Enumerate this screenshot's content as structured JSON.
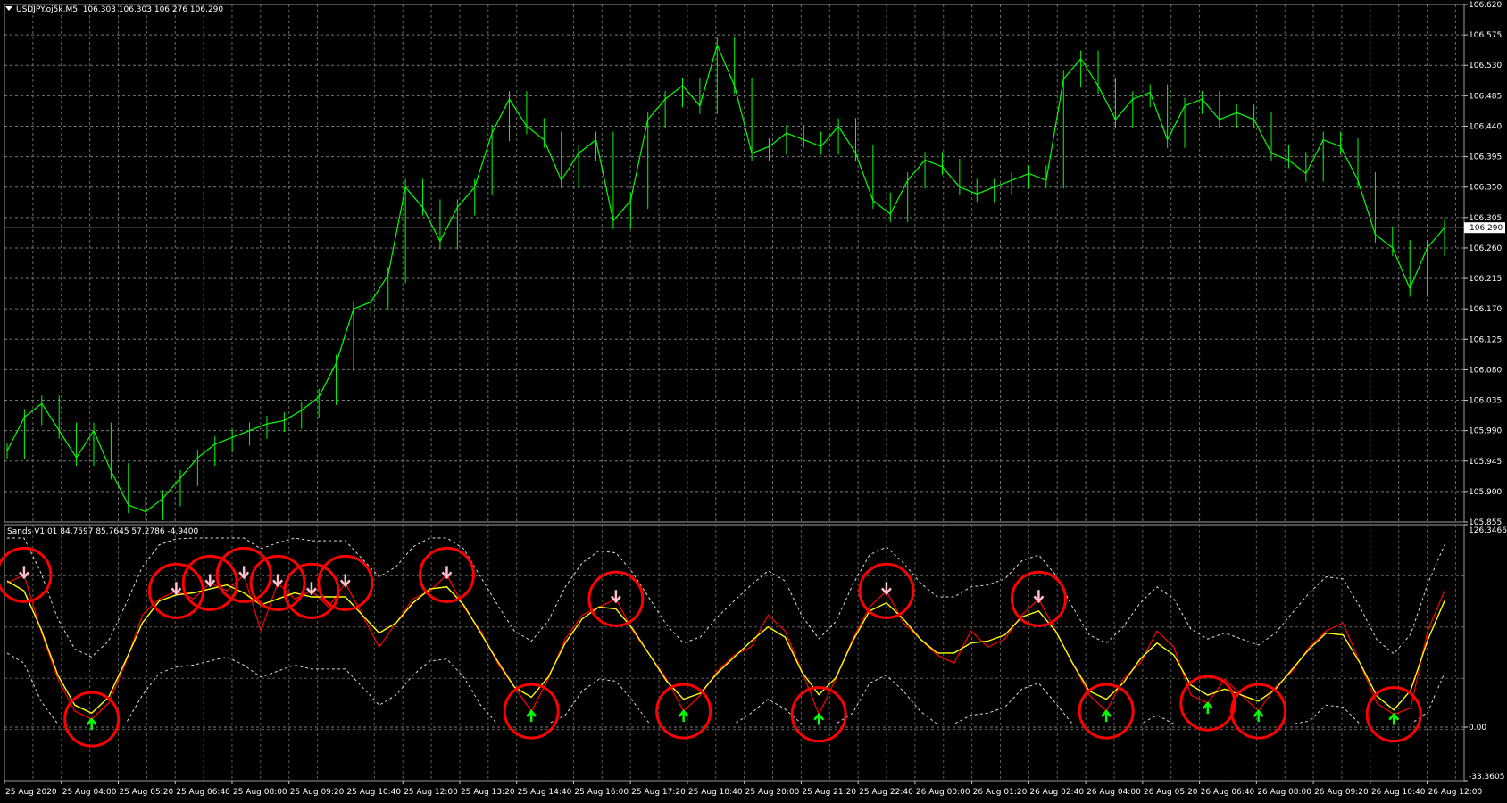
{
  "main_chart": {
    "symbol_label": "USDJPY.oj5k,M5",
    "ohlc_label": "106.303 106.303 106.276 106.290",
    "price_axis_labels": [
      "106.620",
      "106.575",
      "106.530",
      "106.485",
      "106.440",
      "106.395",
      "106.350",
      "106.305",
      "106.260",
      "106.215",
      "106.170",
      "106.125",
      "106.080",
      "106.035",
      "105.990",
      "105.945",
      "105.900",
      "105.855"
    ],
    "current_price_label": "106.290",
    "ylim": [
      105.855,
      106.62
    ],
    "colors": {
      "background": "#000000",
      "grid": "#808080",
      "candles": "#00ff00",
      "axis_text": "#ffffff",
      "price_line": "#c0c0c0"
    }
  },
  "indicator": {
    "label": "Sands V1.01 84.7597 85.7645 57.2786 -4.9400",
    "axis_labels": [
      "126.3466",
      "0.00",
      "-33.3605"
    ],
    "ylim": [
      -33.3605,
      126.3466
    ],
    "colors": {
      "fast_line": "#ff0000",
      "slow_line": "#ffff00",
      "bands": "#ffffff",
      "signal_circle": "#ff0000",
      "buy_arrow": "#00ff00",
      "sell_arrow": "#ffc0cb"
    }
  },
  "time_axis_labels": [
    "25 Aug 2020",
    "25 Aug 04:00",
    "25 Aug 05:20",
    "25 Aug 06:40",
    "25 Aug 08:00",
    "25 Aug 09:20",
    "25 Aug 10:40",
    "25 Aug 12:00",
    "25 Aug 13:20",
    "25 Aug 14:40",
    "25 Aug 16:00",
    "25 Aug 17:20",
    "25 Aug 18:40",
    "25 Aug 20:00",
    "25 Aug 21:20",
    "25 Aug 22:40",
    "26 Aug 00:00",
    "26 Aug 01:20",
    "26 Aug 02:40",
    "26 Aug 04:00",
    "26 Aug 05:20",
    "26 Aug 06:40",
    "26 Aug 08:00",
    "26 Aug 09:20",
    "26 Aug 10:40",
    "26 Aug 12:00"
  ],
  "chart_data": {
    "type": "line",
    "series": [
      {
        "name": "USDJPY.oj5k,M5",
        "values": [
          105.96,
          106.01,
          106.03,
          105.99,
          105.95,
          105.99,
          105.93,
          105.88,
          105.87,
          105.89,
          105.92,
          105.95,
          105.97,
          105.98,
          105.99,
          106.0,
          106.005,
          106.02,
          106.04,
          106.09,
          106.17,
          106.18,
          106.22,
          106.35,
          106.32,
          106.27,
          106.32,
          106.35,
          106.43,
          106.48,
          106.44,
          106.42,
          106.36,
          106.4,
          106.42,
          106.3,
          106.33,
          106.45,
          106.48,
          106.5,
          106.47,
          106.56,
          106.5,
          106.4,
          106.41,
          106.43,
          106.42,
          106.41,
          106.44,
          106.4,
          106.33,
          106.31,
          106.36,
          106.39,
          106.38,
          106.35,
          106.34,
          106.35,
          106.36,
          106.37,
          106.36,
          106.51,
          106.54,
          106.5,
          106.45,
          106.48,
          106.49,
          106.42,
          106.47,
          106.48,
          106.45,
          106.46,
          106.45,
          106.4,
          106.39,
          106.37,
          106.42,
          106.41,
          106.36,
          106.28,
          106.26,
          106.2,
          106.26,
          106.29
        ]
      },
      {
        "name": "Sands V1.01",
        "values": [
          90,
          95,
          60,
          30,
          10,
          5,
          15,
          40,
          70,
          80,
          85,
          80,
          90,
          85,
          95,
          60,
          90,
          80,
          85,
          75,
          90,
          70,
          50,
          65,
          80,
          85,
          95,
          75,
          60,
          40,
          25,
          10,
          30,
          55,
          70,
          75,
          80,
          60,
          45,
          30,
          10,
          20,
          35,
          45,
          50,
          70,
          60,
          35,
          8,
          30,
          55,
          75,
          85,
          65,
          55,
          45,
          40,
          60,
          50,
          55,
          70,
          80,
          60,
          40,
          20,
          10,
          30,
          40,
          60,
          50,
          20,
          15,
          30,
          20,
          10,
          25,
          35,
          50,
          60,
          65,
          40,
          15,
          8,
          12,
          60,
          85
        ]
      }
    ],
    "xlabel": "",
    "ylabel": ""
  }
}
